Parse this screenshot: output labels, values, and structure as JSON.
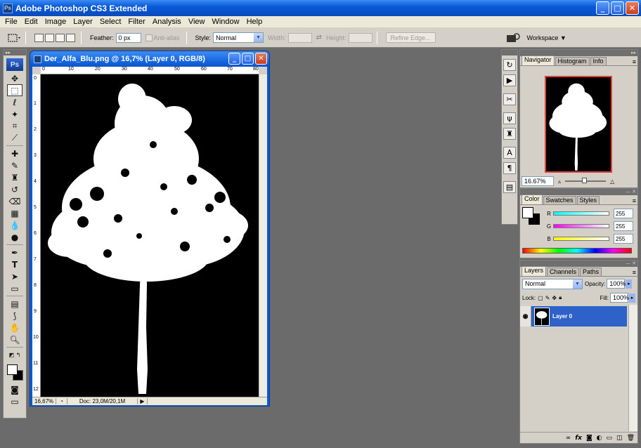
{
  "app": {
    "title": "Adobe Photoshop CS3 Extended",
    "icon_text": "Ps"
  },
  "window_buttons": {
    "min": "_",
    "max": "□",
    "close": "✕"
  },
  "menu": [
    "File",
    "Edit",
    "Image",
    "Layer",
    "Select",
    "Filter",
    "Analysis",
    "View",
    "Window",
    "Help"
  ],
  "options": {
    "feather_label": "Feather:",
    "feather_value": "0 px",
    "antialias_label": "Anti-alias",
    "style_label": "Style:",
    "style_value": "Normal",
    "width_label": "Width:",
    "height_label": "Height:",
    "refine_label": "Refine Edge...",
    "workspace_label": "Workspace ▼"
  },
  "toolbox": {
    "logo": "Ps"
  },
  "document": {
    "title": "Der_Alfa_Blu.png @ 16,7% (Layer 0, RGB/8)",
    "zoom": "16,67%",
    "doc_size": "Doc: 23,0M/20,1M",
    "ruler_ticks": [
      "0",
      "10",
      "20",
      "30",
      "40",
      "50",
      "60",
      "70",
      "80"
    ],
    "vruler_ticks": [
      "0",
      "1",
      "2",
      "3",
      "4",
      "5",
      "6",
      "7",
      "8",
      "9",
      "10",
      "11",
      "12"
    ]
  },
  "navigator": {
    "tabs": [
      "Navigator",
      "Histogram",
      "Info"
    ],
    "zoom": "16.67%"
  },
  "color": {
    "tabs": [
      "Color",
      "Swatches",
      "Styles"
    ],
    "channels": [
      {
        "name": "R",
        "value": "255"
      },
      {
        "name": "G",
        "value": "255"
      },
      {
        "name": "B",
        "value": "255"
      }
    ]
  },
  "layers": {
    "tabs": [
      "Layers",
      "Channels",
      "Paths"
    ],
    "blend": "Normal",
    "opacity_label": "Opacity:",
    "opacity": "100%",
    "lock_label": "Lock:",
    "fill_label": "Fill:",
    "fill": "100%",
    "items": [
      {
        "name": "Layer 0"
      }
    ]
  }
}
